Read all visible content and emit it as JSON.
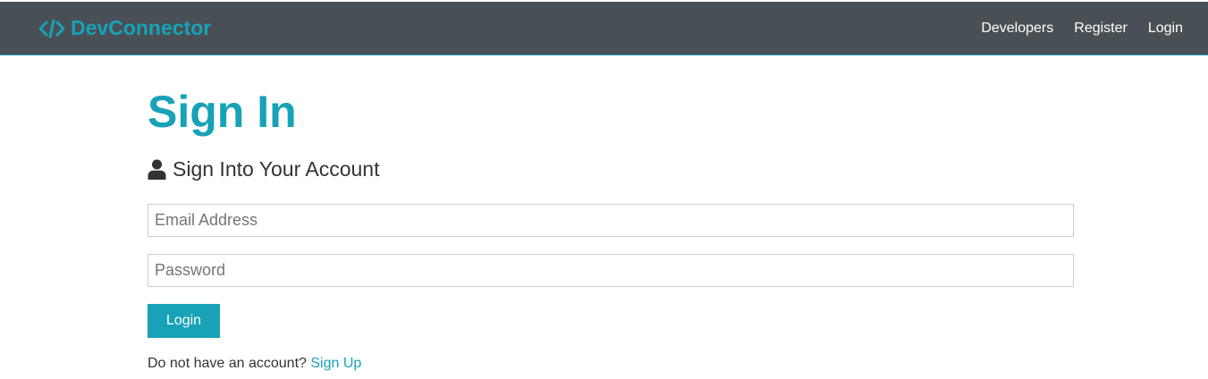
{
  "navbar": {
    "brand_icon": "code-icon",
    "brand_text": "DevConnector",
    "links": [
      {
        "label": "Developers"
      },
      {
        "label": "Register"
      },
      {
        "label": "Login"
      }
    ]
  },
  "main": {
    "title": "Sign In",
    "lead_icon": "user-icon",
    "lead_text": "Sign Into Your Account",
    "email_placeholder": "Email Address",
    "email_value": "",
    "password_placeholder": "Password",
    "password_value": "",
    "login_button_label": "Login",
    "signup_prompt": "Do not have an account?",
    "signup_link_label": "Sign Up"
  },
  "colors": {
    "primary": "#17a2b8",
    "navbar_bg": "#495055",
    "text": "#333333"
  }
}
